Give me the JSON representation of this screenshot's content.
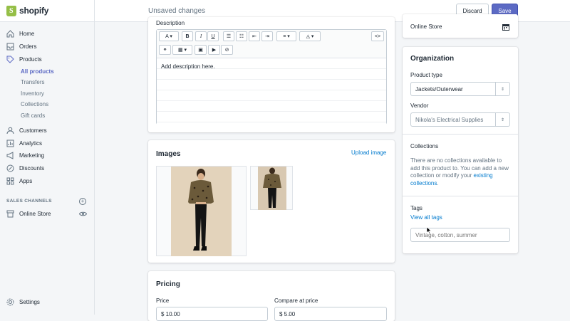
{
  "app": {
    "brand": "shopify",
    "status_title": "Unsaved changes"
  },
  "actions": {
    "discard": "Discard",
    "save": "Save"
  },
  "nav": {
    "home": "Home",
    "orders": "Orders",
    "products": "Products",
    "products_sub": [
      "All products",
      "Transfers",
      "Inventory",
      "Collections",
      "Gift cards"
    ],
    "customers": "Customers",
    "analytics": "Analytics",
    "marketing": "Marketing",
    "discounts": "Discounts",
    "apps": "Apps",
    "sales_channels": "SALES CHANNELS",
    "online_store": "Online Store",
    "settings": "Settings"
  },
  "description": {
    "label": "Description",
    "content": "Add description here."
  },
  "images": {
    "title": "Images",
    "upload": "Upload image"
  },
  "pricing": {
    "title": "Pricing",
    "price_label": "Price",
    "price_value": "$ 10.00",
    "compare_label": "Compare at price",
    "compare_value": "$ 5.00"
  },
  "availability": {
    "channel": "Online Store"
  },
  "organization": {
    "title": "Organization",
    "product_type_label": "Product type",
    "product_type_value": "Jackets/Outerwear",
    "vendor_label": "Vendor",
    "vendor_value": "Nikola's Electrical Supplies",
    "collections_label": "Collections",
    "collections_text": "There are no collections available to add this product to. You can add a new collection or modify your",
    "collections_link": "existing collections",
    "tags_label": "Tags",
    "tags_link": "View all tags",
    "tags_placeholder": "Vintage, cotton, summer"
  },
  "colors": {
    "accent": "#5c6ac4",
    "link": "#007ace",
    "brand": "#95bf47"
  }
}
